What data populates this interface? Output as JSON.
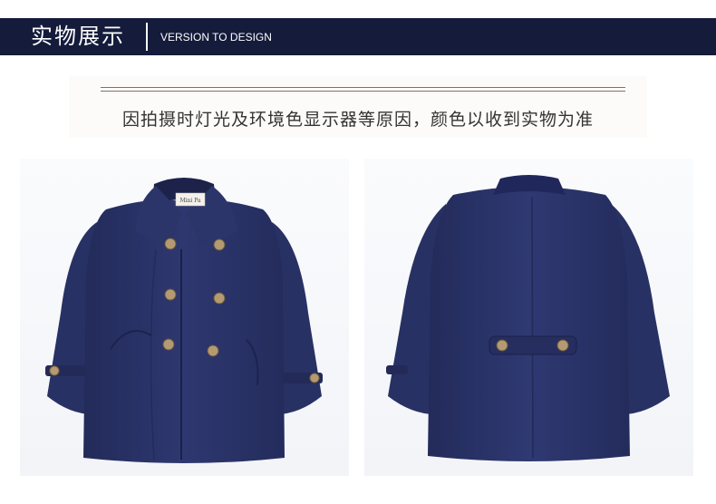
{
  "header": {
    "title": "实物展示",
    "subtitle": "VERSION TO DESIGN"
  },
  "notice": {
    "text": "因拍摄时灯光及环境色显示器等原因，颜色以收到实物为准"
  },
  "photos": {
    "front_label_text": "Mini Pa",
    "colors": {
      "coat": "#2b3468",
      "coat_dark": "#1f2552",
      "button": "#b49a72"
    }
  }
}
